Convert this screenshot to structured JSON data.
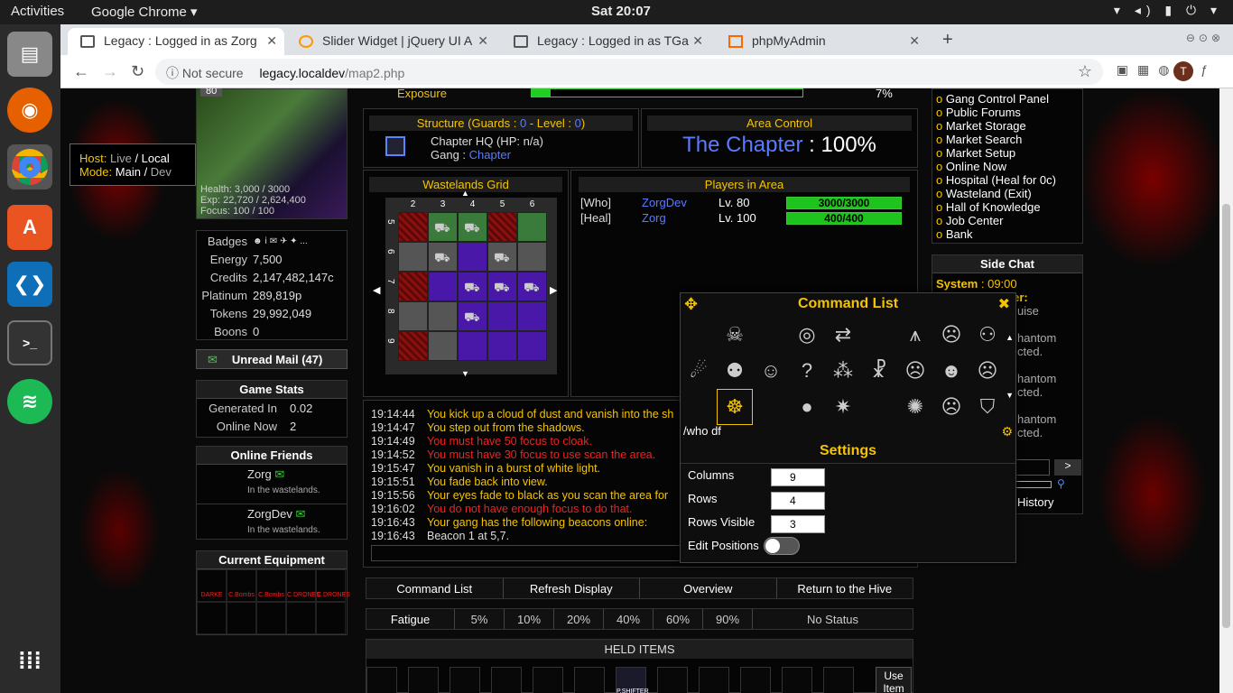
{
  "topbar": {
    "activities": "Activities",
    "app": "Google Chrome ▾",
    "clock": "Sat 20:07",
    "tray": "▾ ◂) ▮ ⏻ ▾"
  },
  "tabs": [
    {
      "label": "Legacy : Logged in as Zorg",
      "close": "✕"
    },
    {
      "label": "Slider Widget | jQuery UI A",
      "close": "✕"
    },
    {
      "label": "Legacy : Logged in as TGa",
      "close": "✕"
    },
    {
      "label": "phpMyAdmin",
      "close": "✕"
    }
  ],
  "newtab": "+",
  "url": {
    "nsicon": "ⓘ",
    "notsecure": "Not secure",
    "host": "legacy.localdev",
    "path": "/map2.php"
  },
  "profile": "T",
  "host_tip": {
    "host_k": "Host:",
    "host_live": "Live",
    "host_local": "Local",
    "mode_k": "Mode:",
    "mode_main": "Main",
    "mode_dev": "Dev"
  },
  "char": {
    "level": "80",
    "health_k": "Health:",
    "health": "3,000 / 3000",
    "exp_k": "Exp:",
    "exp": "22,720 / 2,624,400",
    "focus_k": "Focus:",
    "focus": "100 / 100"
  },
  "stats": [
    {
      "k": "Badges",
      "v": "☻ ⅰ ✉ ✈ ✦ ..."
    },
    {
      "k": "Energy",
      "v": "7,500"
    },
    {
      "k": "Credits",
      "v": "2,147,482,147c"
    },
    {
      "k": "Platinum",
      "v": "289,819p"
    },
    {
      "k": "Tokens",
      "v": "29,992,049"
    },
    {
      "k": "Boons",
      "v": "0"
    }
  ],
  "mail": "Unread Mail (47)",
  "gamestats": {
    "title": "Game Stats",
    "gen_k": "Generated In",
    "gen_v": "0.02",
    "online_k": "Online Now",
    "online_v": "2"
  },
  "friends": {
    "title": "Online Friends",
    "items": [
      {
        "name": "Zorg",
        "loc": "In the wastelands."
      },
      {
        "name": "ZorgDev",
        "loc": "In the wastelands."
      }
    ]
  },
  "equipment": {
    "title": "Current Equipment",
    "items": [
      "DARKE",
      "C.Bombs",
      "C.Bombs",
      "C.DRONES",
      "C.DRONES"
    ]
  },
  "exposure": {
    "label": "Exposure",
    "pct": "7%",
    "fill": 0.07
  },
  "structure": {
    "title_a": "Structure",
    "title_b": "(Guards :",
    "guards": "0",
    "title_c": "- Level :",
    "level": "0",
    "title_d": ")",
    "name": "Chapter HQ (HP: n/a)",
    "gang_k": "Gang :",
    "gang_v": "Chapter"
  },
  "area": {
    "title": "Area Control",
    "gang": "The Chapter",
    "colon": ":",
    "pct": "100%"
  },
  "grid": {
    "title": "Wastelands Grid",
    "cols": [
      "2",
      "3",
      "4",
      "5",
      "6"
    ],
    "rows": [
      "5",
      "6",
      "7",
      "8",
      "9"
    ]
  },
  "players": {
    "title": "Players in Area",
    "list": [
      {
        "role": "[Who]",
        "name": "ZorgDev",
        "lv": "Lv. 80",
        "hp": "3000/3000",
        "fill": 1.0
      },
      {
        "role": "[Heal]",
        "name": "Zorg",
        "lv": "Lv. 100",
        "hp": "400/400",
        "fill": 1.0
      }
    ]
  },
  "log": [
    {
      "t": "19:14:44",
      "m": "You kick up a cloud of dust and vanish into the sh",
      "c": "gold"
    },
    {
      "t": "19:14:47",
      "m": "You step out from the shadows.",
      "c": "gold"
    },
    {
      "t": "19:14:49",
      "m": "You must have 50 focus to cloak.",
      "c": "red"
    },
    {
      "t": "19:14:52",
      "m": "You must have 30 focus to use scan the area.",
      "c": "red"
    },
    {
      "t": "19:15:47",
      "m": "You vanish in a burst of white light.",
      "c": "gold"
    },
    {
      "t": "19:15:51",
      "m": "You fade back into view.",
      "c": "gold"
    },
    {
      "t": "19:15:56",
      "m": "Your eyes fade to black as you scan the area for",
      "c": "gold"
    },
    {
      "t": "19:16:02",
      "m": "You do not have enough focus to do that.",
      "c": "red"
    },
    {
      "t": "19:16:43",
      "m": "Your gang has the following beacons online:",
      "c": "gold"
    },
    {
      "t": "19:16:43",
      "m": "Beacon 1 at 5,7.",
      "c": "white"
    }
  ],
  "actions": [
    "Command List",
    "Refresh Display",
    "Overview",
    "Return to the Hive"
  ],
  "fatigue": [
    "Fatigue",
    "5%",
    "10%",
    "20%",
    "40%",
    "60%",
    "90%",
    "No Status"
  ],
  "held": {
    "title": "HELD ITEMS",
    "item": "P.SHIFTER",
    "use": "Use Item"
  },
  "rightlinks": [
    "Gang Control Panel",
    "Public Forums",
    "Market Storage",
    "Market Search",
    "Market Setup",
    "Online Now",
    "Hospital (Heal for 0c)",
    "Wasteland (Exit)",
    "Hall of Knowledge",
    "Job Center",
    "Bank"
  ],
  "sidechat": {
    "title": "Side Chat",
    "sys": "System",
    "time": ": 09:00",
    "lines": [
      "Pot Dog Winner:",
      "uise",
      "hantom",
      "cted.",
      "hantom",
      "cted.",
      "hantom",
      "cted."
    ],
    "send": ">",
    "history": "History"
  },
  "cmd": {
    "title": "Command List",
    "move": "✥",
    "close": "✖",
    "input": "/who df",
    "settings_title": "Settings",
    "gear": "⚙",
    "settings": [
      {
        "k": "Columns",
        "v": "9"
      },
      {
        "k": "Rows",
        "v": "4"
      },
      {
        "k": "Rows Visible",
        "v": "3"
      }
    ],
    "edit": "Edit Positions",
    "edit_on": false,
    "icons": [
      "",
      "wolf-head-icon",
      "",
      "radar-user-icon",
      "swap-arrows-icon",
      "",
      "grass-spikes-icon",
      "sleepy-face-icon",
      "user-minus-icon",
      "flaming-comet-icon",
      "group-icon",
      "goggle-face-icon",
      "user-question-icon",
      "footprints-icon",
      "people-icon",
      "neutral-face-icon",
      "user-icon",
      "wink-face-icon",
      "",
      "flame-sigil-icon",
      "",
      "bomb-icon",
      "explosion-icon",
      "",
      "sparks-people-icon",
      "sad-face-icon",
      "shield-icon"
    ],
    "glyphs": [
      "",
      "☠",
      "",
      "◎",
      "⇄",
      "",
      "⩚",
      "☹",
      "⚇",
      "☄",
      "⚉",
      "☺",
      "?",
      "⁂",
      "☧",
      "☹",
      "☻",
      "☹",
      "",
      "☸",
      "",
      "●",
      "✷",
      "",
      "✺",
      "☹",
      "⛉"
    ]
  }
}
